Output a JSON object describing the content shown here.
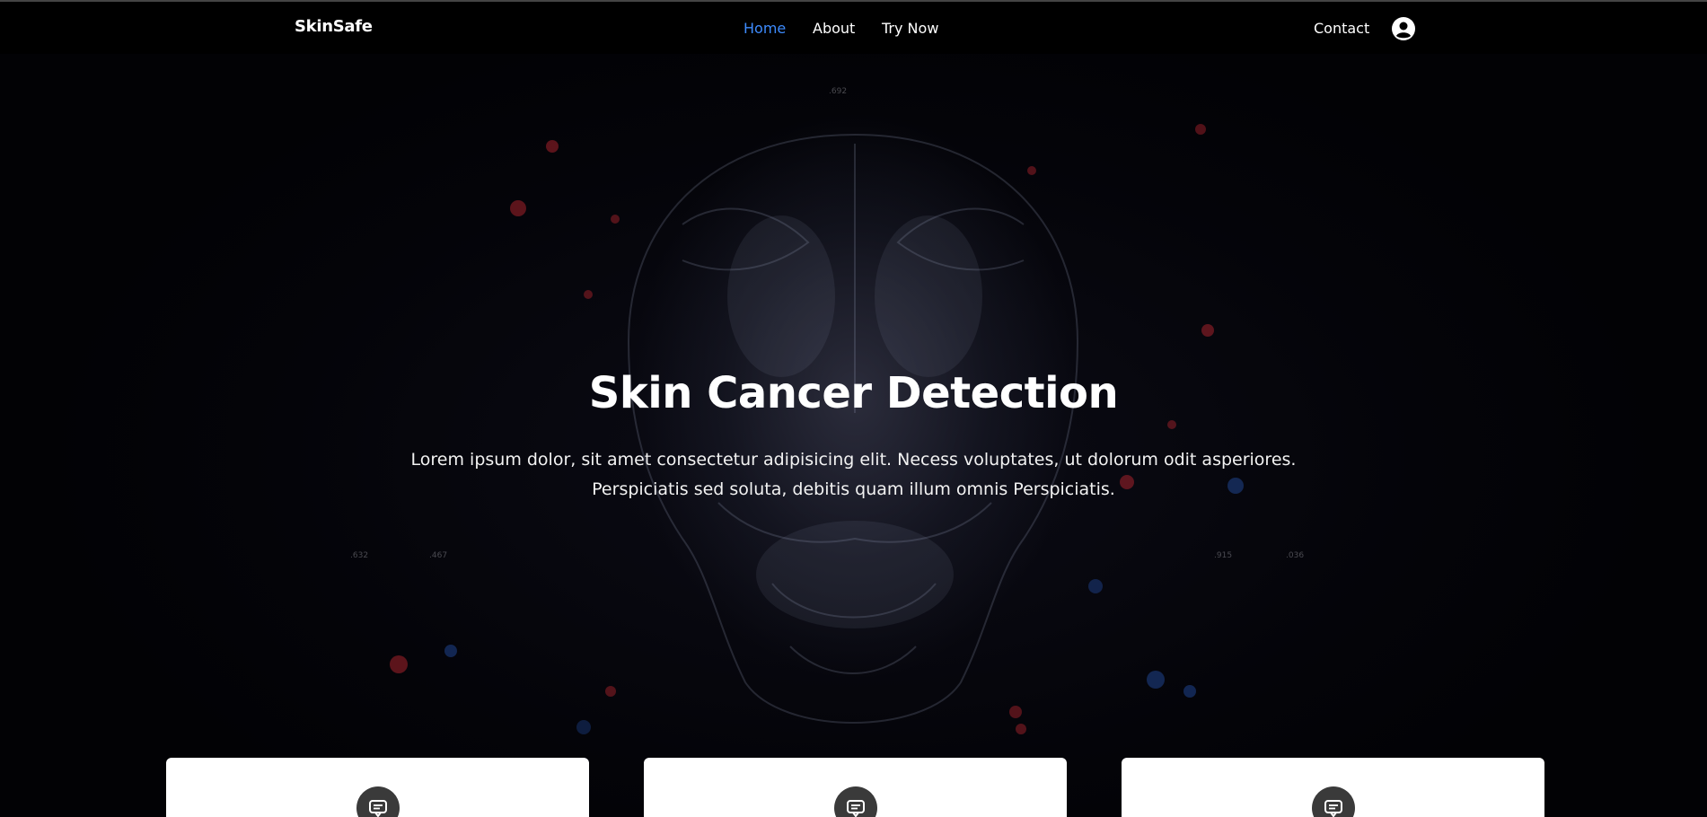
{
  "navbar": {
    "brand": "SkinSafe",
    "links": [
      {
        "label": "Home",
        "active": true
      },
      {
        "label": "About",
        "active": false
      },
      {
        "label": "Try Now",
        "active": false
      }
    ],
    "contact_label": "Contact",
    "user_icon": "user-circle-icon",
    "active_color": "#3d8bfd"
  },
  "hero": {
    "title": "Skin Cancer Detection",
    "text_line1": "Lorem ipsum dolor, sit amet consectetur adipisicing elit. Necess voluptates, ut dolorum odit asperiores.",
    "text_line2": "Perspiciatis sed soluta, debitis quam illum omnis Perspiciatis.",
    "background_labels": [
      ".692",
      ".632",
      ".467",
      ".915",
      ".036"
    ]
  },
  "cards": [
    {
      "icon": "chat-message-icon"
    },
    {
      "icon": "chat-message-icon"
    },
    {
      "icon": "chat-message-icon"
    }
  ]
}
